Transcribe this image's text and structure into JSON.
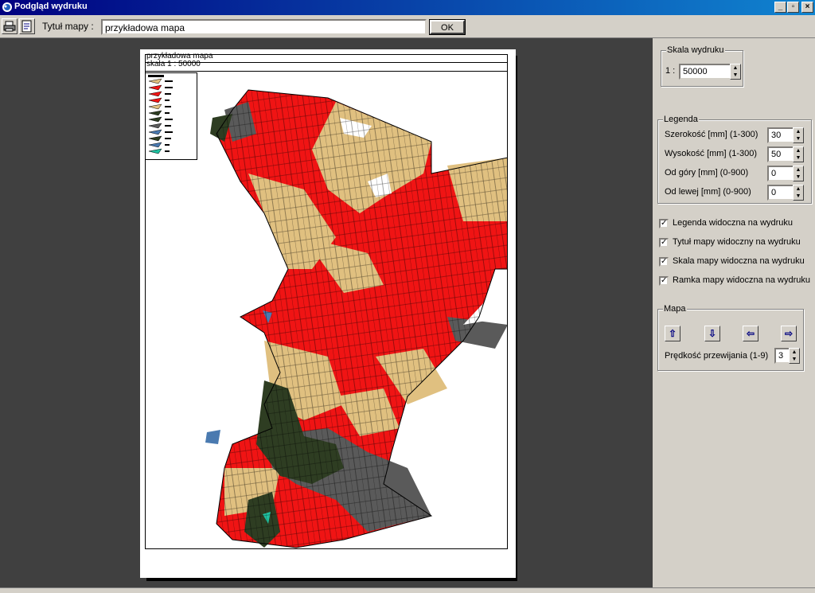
{
  "window": {
    "title": "Podgląd wydruku"
  },
  "toolbar": {
    "title_label": "Tytuł mapy :",
    "title_value": "przykładowa mapa",
    "ok_label": "OK"
  },
  "map": {
    "title": "przykładowa mapa",
    "scale_text": "skala 1 : 50000",
    "colors": {
      "red": "#f01414",
      "tan": "#e0c080",
      "gray": "#5a5a5a",
      "dark_green": "#2e3d22",
      "blue": "#4a7ab0",
      "teal": "#20c0a0"
    }
  },
  "panel": {
    "scale_group": {
      "title": "Skala wydruku",
      "prefix": "1 :",
      "value": "50000"
    },
    "legend_group": {
      "title": "Legenda",
      "fields": [
        {
          "label": "Szerokość [mm] (1-300)",
          "value": "30"
        },
        {
          "label": "Wysokość [mm] (1-300)",
          "value": "50"
        },
        {
          "label": "Od góry [mm] (0-900)",
          "value": "0"
        },
        {
          "label": "Od lewej [mm] (0-900)",
          "value": "0"
        }
      ]
    },
    "checkboxes": [
      {
        "label": "Legenda widoczna na wydruku",
        "checked": true
      },
      {
        "label": "Tytuł mapy widoczny na wydruku",
        "checked": true
      },
      {
        "label": "Skala mapy widoczna na wydruku",
        "checked": true
      },
      {
        "label": "Ramka mapy widoczna na wydruku",
        "checked": true
      }
    ],
    "map_group": {
      "title": "Mapa",
      "speed_label": "Prędkość przewijania (1-9)",
      "speed_value": "3"
    }
  }
}
